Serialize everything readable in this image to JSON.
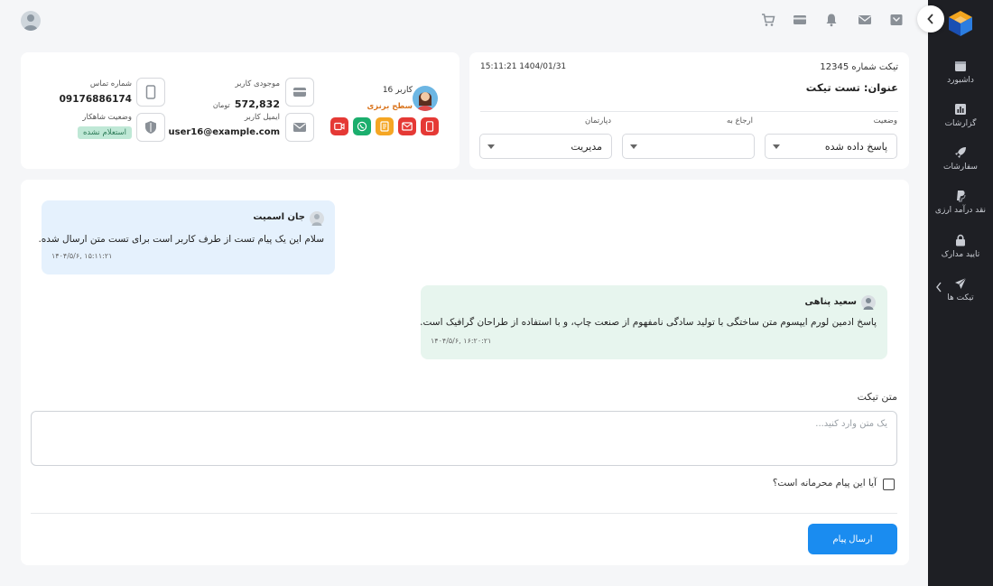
{
  "sidebar": {
    "items": [
      {
        "label": "داشبورد",
        "icon": "calendar-icon"
      },
      {
        "label": "گزارشات",
        "icon": "chart-icon"
      },
      {
        "label": "سفارشات",
        "icon": "rocket-icon"
      },
      {
        "label": "نقد درآمد ارزی",
        "icon": "paypal-icon"
      },
      {
        "label": "تایید مدارک",
        "icon": "lock-icon"
      },
      {
        "label": "تیکت ها",
        "icon": "send-icon"
      }
    ]
  },
  "ticket": {
    "number": "تیکت شماره 12345",
    "datetime": "15:11:21 1404/01/31",
    "title_label": "عنوان:",
    "title_value": "تست تیکت",
    "status_label": "وضعیت",
    "status_value": "پاسخ داده شده",
    "refer_label": "ارجاع به",
    "refer_value": "",
    "department_label": "دپارتمان",
    "department_value": "مدیریت"
  },
  "user": {
    "name": "کاربر 16",
    "level": "سطح برنزی",
    "balance_label": "موجودی کاربر",
    "balance_value": "572,832",
    "balance_unit": "تومان",
    "email_label": "ایمیل کاربر",
    "email_value": "user16@example.com",
    "phone_label": "شماره تماس",
    "phone_value": "09176886174",
    "shahkar_label": "وضعیت شاهکار",
    "shahkar_value": "استعلام نشده"
  },
  "messages": [
    {
      "name": "جان اسمیت",
      "text": "سلام این یک پیام تست از طرف کاربر است برای تست متن ارسال شده.",
      "time": "۱۵:۱۱:۲۱ ,۱۴۰۴/۵/۶"
    },
    {
      "name": "سعید پناهی",
      "text": "پاسخ ادمین لورم ایپسوم متن ساختگی با تولید سادگی نامفهوم از صنعت چاپ، و با استفاده از طراحان گرافیک است.",
      "time": "۱۶:۲۰:۲۱ ,۱۴۰۴/۵/۶"
    }
  ],
  "reply": {
    "label": "متن تیکت",
    "placeholder": "یک متن وارد کنید...",
    "private_label": "آیا این پیام محرمانه است؟",
    "send_label": "ارسال پیام"
  },
  "colors": {
    "sidebar_bg": "#1e1f24",
    "send_button": "#1a8cf0",
    "user_message_bg": "#e5f1fd",
    "admin_message_bg": "#e7f5ee",
    "level_text": "#d9731b",
    "shahkar_badge_bg": "#bfe8d6"
  }
}
